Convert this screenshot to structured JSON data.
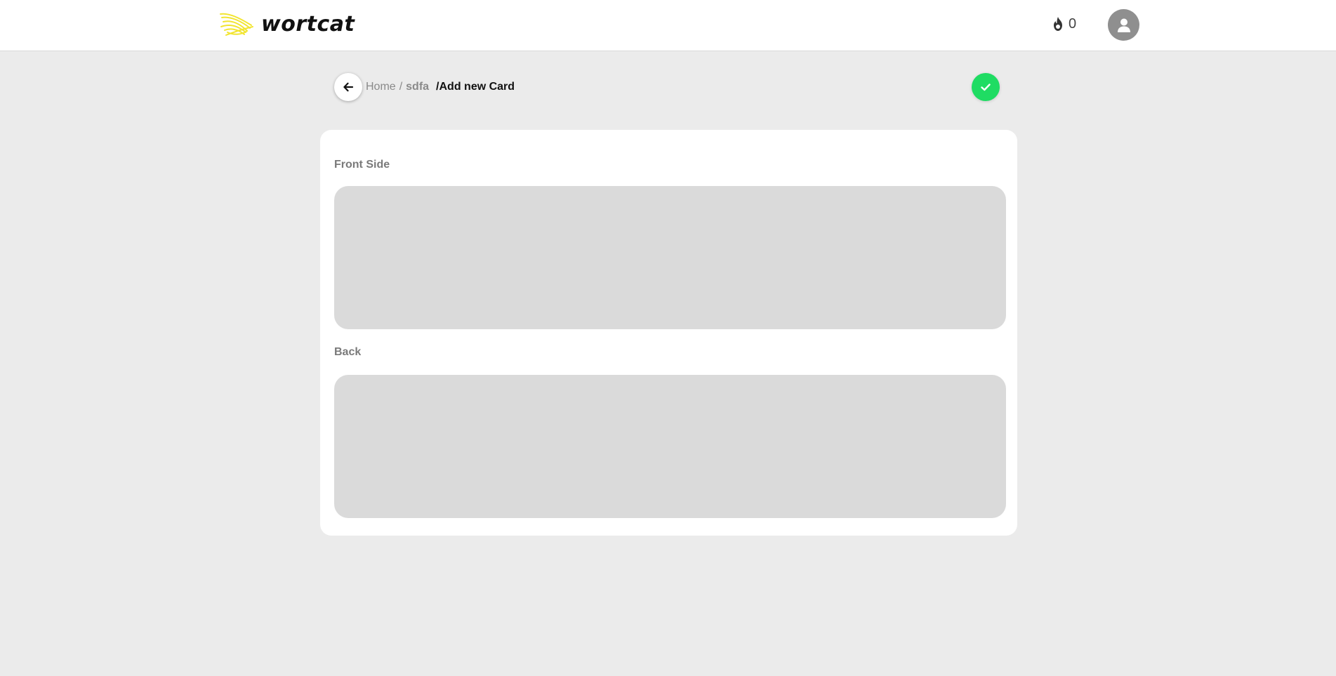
{
  "app": {
    "brand": "wortcat",
    "accent_color": "#1fdc63",
    "logo_color": "#f2e531"
  },
  "header": {
    "streak_icon": "flame-icon",
    "streak_count": "0",
    "avatar_icon": "user-icon"
  },
  "breadcrumb": {
    "back_icon": "arrow-left-icon",
    "home": "Home",
    "separator": "/",
    "deck": "sdfa",
    "current": "/Add new Card"
  },
  "actions": {
    "save_icon": "check-icon"
  },
  "form": {
    "front_label": "Front Side",
    "front_value": "",
    "back_label": "Back",
    "back_value": ""
  }
}
